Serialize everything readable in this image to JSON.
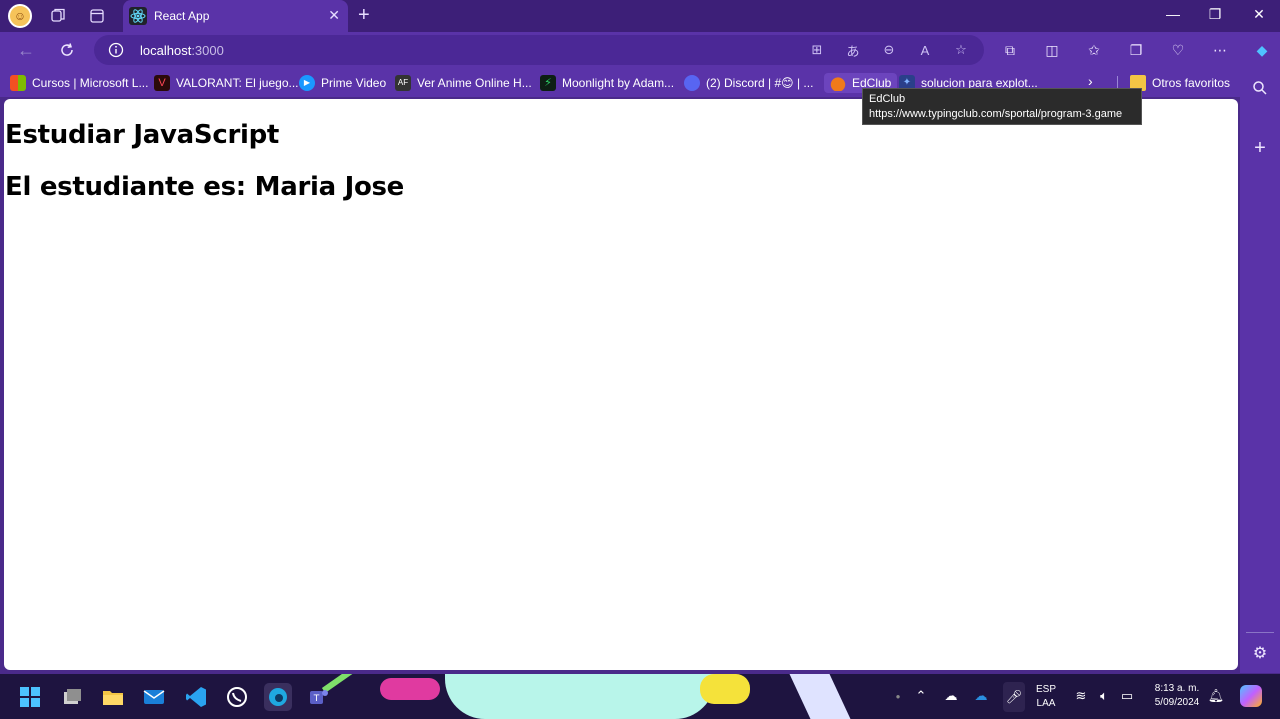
{
  "browser": {
    "tab": {
      "title": "React App",
      "close": "✕"
    },
    "new_tab": "+",
    "window_controls": {
      "minimize": "—",
      "maximize": "❐",
      "close": "✕"
    },
    "address": {
      "host": "localhost",
      "port": ":3000"
    },
    "favorites": [
      {
        "label": "Cursos | Microsoft L...",
        "icon": "microsoft-icon",
        "color": "#f25022"
      },
      {
        "label": "VALORANT: El juego...",
        "icon": "valorant-icon",
        "color": "#ff4655"
      },
      {
        "label": "Prime Video",
        "icon": "prime-video-icon",
        "color": "#1a98ff"
      },
      {
        "label": "Ver Anime Online H...",
        "icon": "animeflv-icon",
        "color": "#333333"
      },
      {
        "label": "Moonlight by Adam...",
        "icon": "moonlight-icon",
        "color": "#1a9a4a"
      },
      {
        "label": "(2) Discord | #😊 | ...",
        "icon": "discord-icon",
        "color": "#5865f2"
      },
      {
        "label": "EdClub",
        "icon": "edclub-icon",
        "color": "#f07a1a"
      },
      {
        "label": "solucion para explot...",
        "icon": "link-icon",
        "color": "#7fb2ff"
      }
    ],
    "favorites_more": "›",
    "other_favorites": "Otros favoritos",
    "tooltip": {
      "title": "EdClub",
      "url": "https://www.typingclub.com/sportal/program-3.game"
    }
  },
  "page": {
    "heading1": "Estudiar JavaScript",
    "heading2": "El estudiante es: Maria Jose"
  },
  "taskbar": {
    "language": "ESP",
    "layout": "LAA",
    "time": "8:13 a. m.",
    "date": "5/09/2024"
  },
  "colors": {
    "browser_frame": "#5a33a8",
    "title_bar": "#3d1f78",
    "page_bg": "#ffffff"
  }
}
